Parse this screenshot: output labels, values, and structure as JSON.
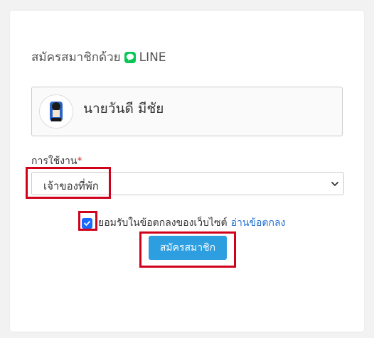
{
  "form": {
    "title": "สมัครสมาชิกด้วย",
    "line_label": "LINE",
    "profile_name": "นายวันดี มีชัย",
    "usage_label": "การใช้งาน",
    "required_mark": "*",
    "usage_value": "เจ้าของที่พัก",
    "agree_text": "ยอมรับในข้อตกลงของเว็บไซต์",
    "agree_link": "อ่านข้อตกลง",
    "agree_checked": true,
    "submit_label": "สมัครสมาชิก"
  },
  "colors": {
    "line_green": "#06c755",
    "button_blue": "#2d9ee0",
    "checkbox_blue": "#1769ff",
    "link_blue": "#1f6fd1",
    "highlight_red": "#d0021b",
    "required_red": "#d9302f"
  },
  "icons": {
    "line": "line-logo-icon",
    "avatar": "avatar",
    "chevron": "chevron-down-icon",
    "check": "check-icon"
  }
}
